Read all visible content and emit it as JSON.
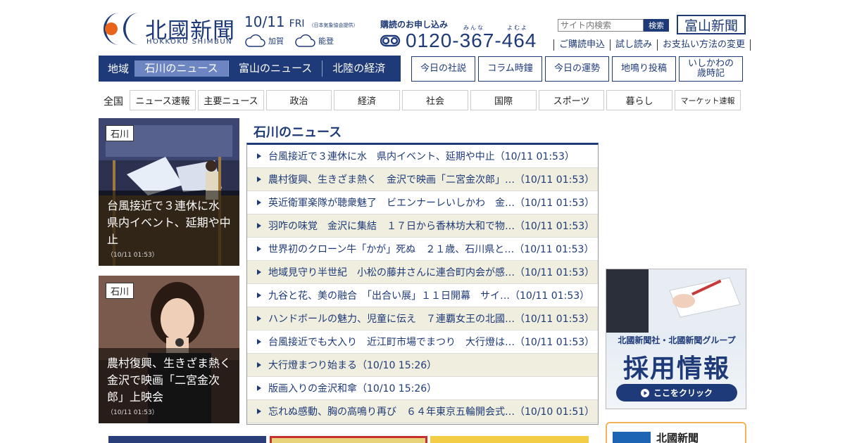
{
  "header": {
    "logo_title": "北國新聞",
    "logo_sub": "HOKKOKU SHIMBUN",
    "date": "10/11",
    "weekday": "FRI",
    "weather_credit": "（日本気象協会提供）",
    "weather": [
      {
        "area": "加賀",
        "icon": "cloud-icon"
      },
      {
        "area": "能登",
        "icon": "cloud-icon"
      }
    ],
    "subscribe_label": "購読のお申し込み",
    "ruby_1": "みんな",
    "ruby_2": "よむよ",
    "phone": "0120-367-464",
    "search_placeholder": "サイト内検索",
    "search_button": "検索",
    "toyama_button": "富山新聞",
    "subs_links": [
      "ご購読申込",
      "試し読み",
      "お支払い方法の変更"
    ]
  },
  "region_nav": {
    "label": "地域",
    "tabs": [
      "石川のニュース",
      "富山のニュース",
      "北陸の経済"
    ]
  },
  "features": [
    "今日の社説",
    "コラム時鐘",
    "今日の運勢",
    "地鳴り投稿",
    "いしかわの\n歳時記"
  ],
  "categories": {
    "label": "全国",
    "items": [
      "ニュース速報",
      "主要ニュース",
      "政治",
      "経済",
      "社会",
      "国際",
      "スポーツ",
      "暮らし",
      "マーケット速報"
    ]
  },
  "photos": [
    {
      "tag": "石川",
      "title": "台風接近で３連休に水　県内イベント、延期や中止",
      "time": "（10/11 01:53）"
    },
    {
      "tag": "石川",
      "title": "農村復興、生きざま熱く　金沢で映画「二宮金次郎」上映会",
      "time": "（10/11 01:53）"
    }
  ],
  "news": {
    "title": "石川のニュース",
    "items": [
      "台風接近で３連休に水　県内イベント、延期や中止（10/11 01:53）",
      "農村復興、生きざま熱く　金沢で映画「二宮金次郎」…（10/11 01:53）",
      "英近衛軍楽隊が聴衆魅了　ビエンナーレいしかわ　金…（10/11 01:53）",
      "羽咋の味覚　金沢に集結　１７日から香林坊大和で物…（10/11 01:53）",
      "世界初のクローン牛「かが」死ぬ　２１歳、石川県と…（10/11 01:53）",
      "地域見守り半世紀　小松の藤井さんに連合町内会が感…（10/11 01:53）",
      "九谷と花、美の融合　「出合い展」１１日開幕　サイ…（10/11 01:53）",
      "ハンドボールの魅力、児童に伝え　７連覇女王の北國…（10/11 01:53）",
      "台風接近でも大入り　近江町市場でまつり　大行燈は…（10/11 01:53）",
      "大行燈まつり始まる（10/10 15:26）",
      "版画入りの金沢和傘（10/10 15:26）",
      "忘れぬ感動、胸の高鳴り再び　６４年東京五輪開会式…（10/10 01:51）"
    ]
  },
  "recruit": {
    "line1": "北國新聞社・北國新聞グループ",
    "line2": "採用情報",
    "cta": "ここをクリック"
  },
  "bottom_box": {
    "text": "北國新聞"
  },
  "colors": {
    "brand": "#1e3a78",
    "active_tab": "#6d86c2",
    "row_alt": "#efeedf"
  }
}
